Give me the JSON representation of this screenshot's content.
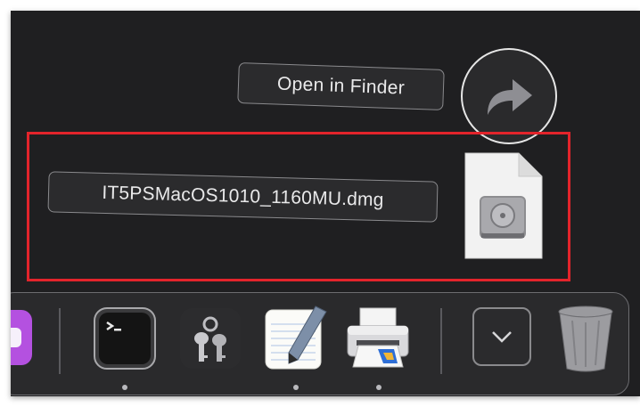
{
  "popover": {
    "open_in_finder_label": "Open in Finder",
    "file_name": "IT5PSMacOS1010_1160MU.dmg",
    "file_icon": "disk-image-file-icon",
    "share_icon": "share-arrow-icon"
  },
  "highlight_color": "#e3242b",
  "dock": {
    "items": [
      {
        "name": "app-partial-purple",
        "icon": "purple-app-icon",
        "running": false
      },
      {
        "name": "terminal",
        "icon": "terminal-icon",
        "running": true
      },
      {
        "name": "keychain-access",
        "icon": "keys-icon",
        "running": false
      },
      {
        "name": "textedit",
        "icon": "textedit-icon",
        "running": true
      },
      {
        "name": "printer",
        "icon": "printer-icon",
        "running": true
      },
      {
        "name": "downloads-stack",
        "icon": "chevron-down-icon",
        "running": false
      },
      {
        "name": "trash",
        "icon": "trash-icon",
        "running": false
      }
    ]
  }
}
